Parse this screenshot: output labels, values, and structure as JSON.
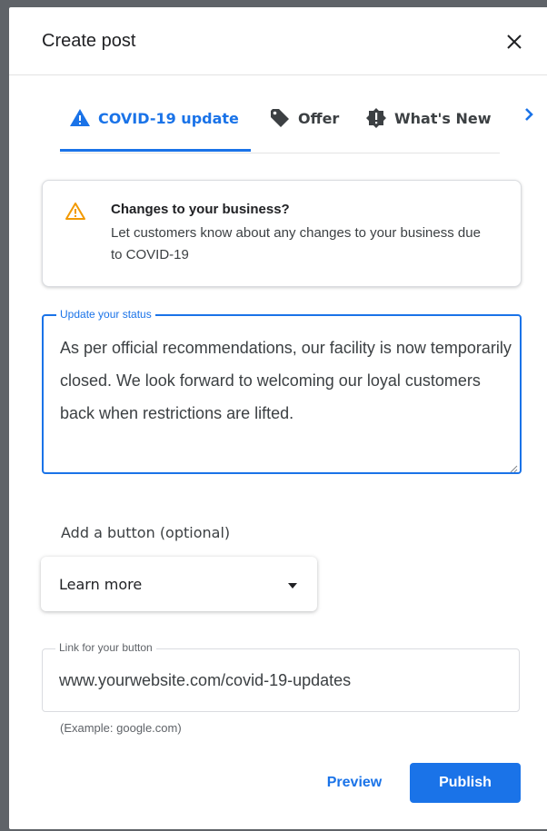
{
  "dialog": {
    "title": "Create post",
    "close_icon": "close-icon"
  },
  "tabs": [
    {
      "label": "COVID-19 update",
      "icon": "warning-triangle-icon",
      "active": true
    },
    {
      "label": "Offer",
      "icon": "tag-icon",
      "active": false
    },
    {
      "label": "What's New",
      "icon": "announcement-icon",
      "active": false
    }
  ],
  "tabs_next_icon": "chevron-right-icon",
  "notice": {
    "icon": "warning-outline-icon",
    "title": "Changes to your business?",
    "body": "Let customers know about any changes to your business due to COVID-19"
  },
  "status_field": {
    "label": "Update your status",
    "value": "As per official recommendations, our facility is now temporarily closed. We look forward to welcoming our loyal customers back when restrictions are lifted."
  },
  "button_section": {
    "label": "Add a button (optional)",
    "selected": "Learn more"
  },
  "link_field": {
    "label": "Link for your button",
    "value": "www.yourwebsite.com/covid-19-updates",
    "helper": "(Example: google.com)"
  },
  "actions": {
    "preview": "Preview",
    "publish": "Publish"
  },
  "colors": {
    "accent": "#1a73e8",
    "warning": "#f29900",
    "text": "#3c4043"
  }
}
